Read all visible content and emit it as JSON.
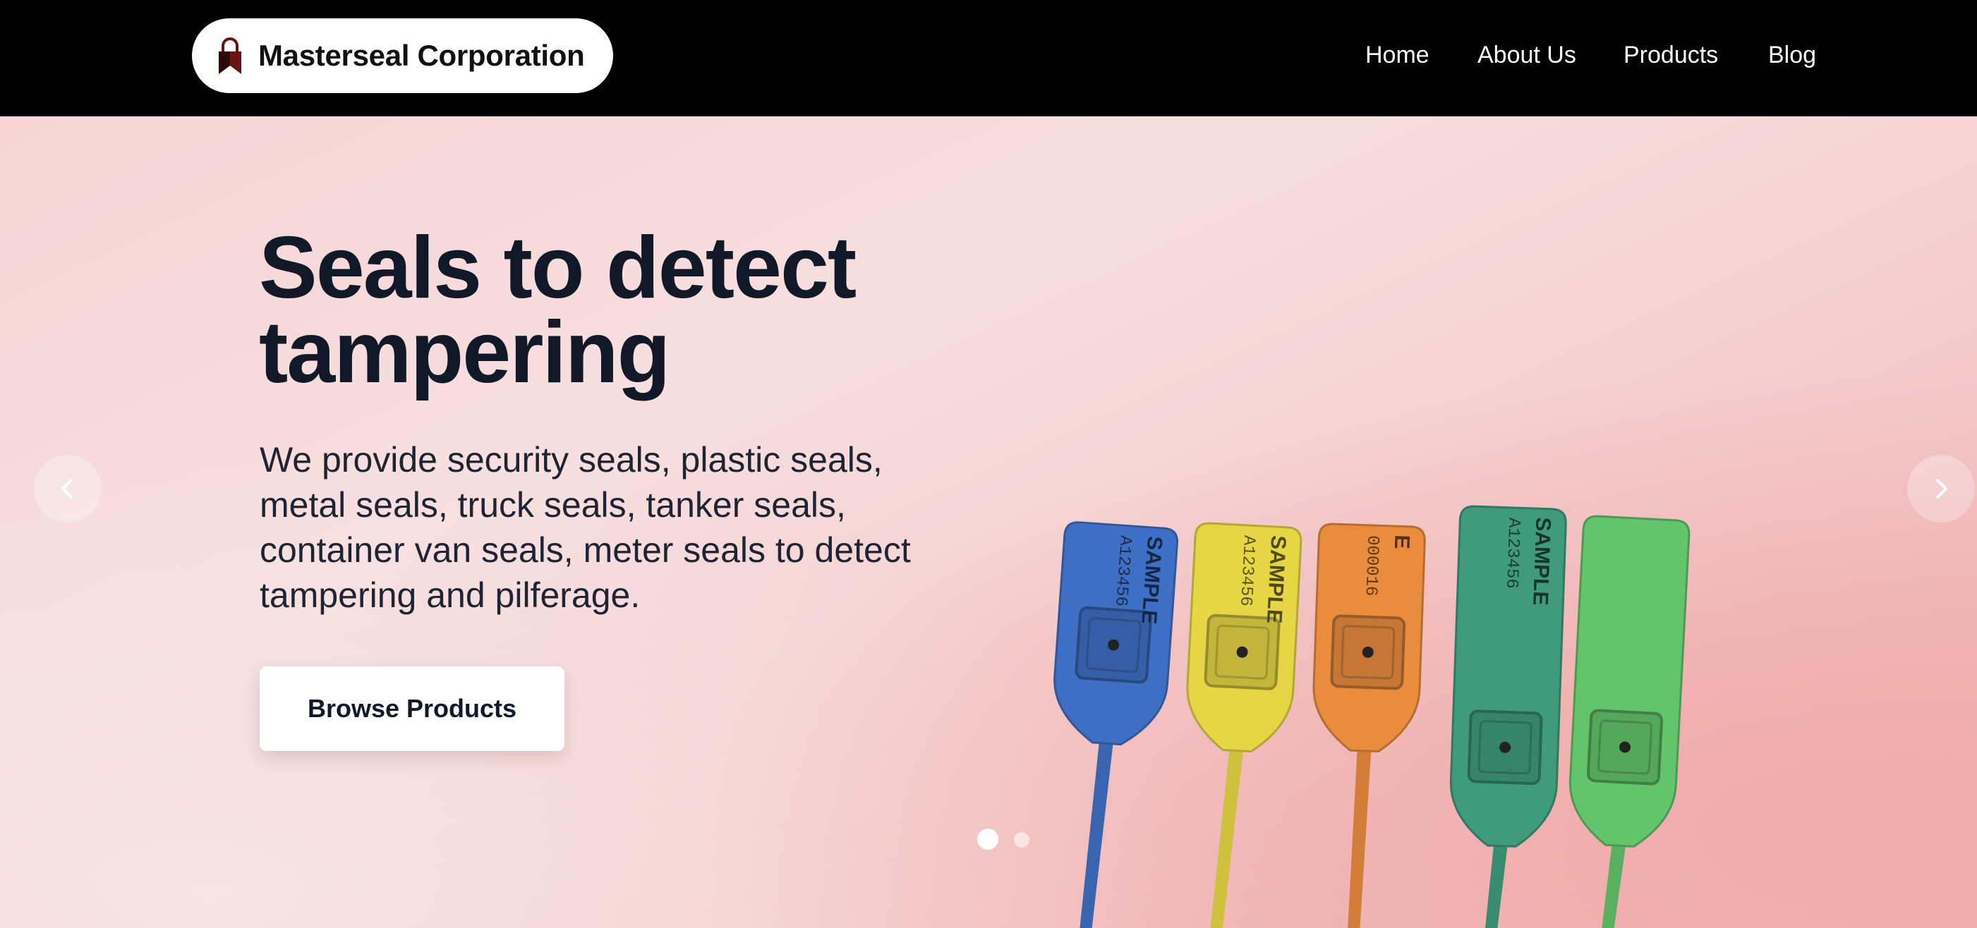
{
  "brand": {
    "name": "Masterseal Corporation",
    "logo_icon": "padlock-logo-icon",
    "logo_color": "#6b1212"
  },
  "nav": {
    "items": [
      {
        "label": "Home"
      },
      {
        "label": "About Us"
      },
      {
        "label": "Products"
      },
      {
        "label": "Blog"
      }
    ]
  },
  "hero": {
    "headline": "Seals to detect tampering",
    "description": "We provide security seals, plastic seals, metal seals, truck seals, tanker seals, container van seals, meter seals to detect tampering and pilferage.",
    "cta_label": "Browse Products",
    "carousel": {
      "prev_icon": "chevron-left-icon",
      "next_icon": "chevron-right-icon",
      "slides_total": 2,
      "active_slide": 1
    },
    "seal_colors": [
      "#3f6fc4",
      "#e6d645",
      "#e98c3e",
      "#3f9b7c",
      "#63c56b"
    ],
    "seal_prints": [
      {
        "text": "SAMPLE",
        "serial": "A123456"
      },
      {
        "text": "SAMPLE",
        "serial": "A123456"
      },
      {
        "text": "E",
        "serial": "000016"
      },
      {
        "text": "SAMPLE",
        "serial": "A123456"
      },
      {
        "text": "",
        "serial": ""
      }
    ]
  }
}
